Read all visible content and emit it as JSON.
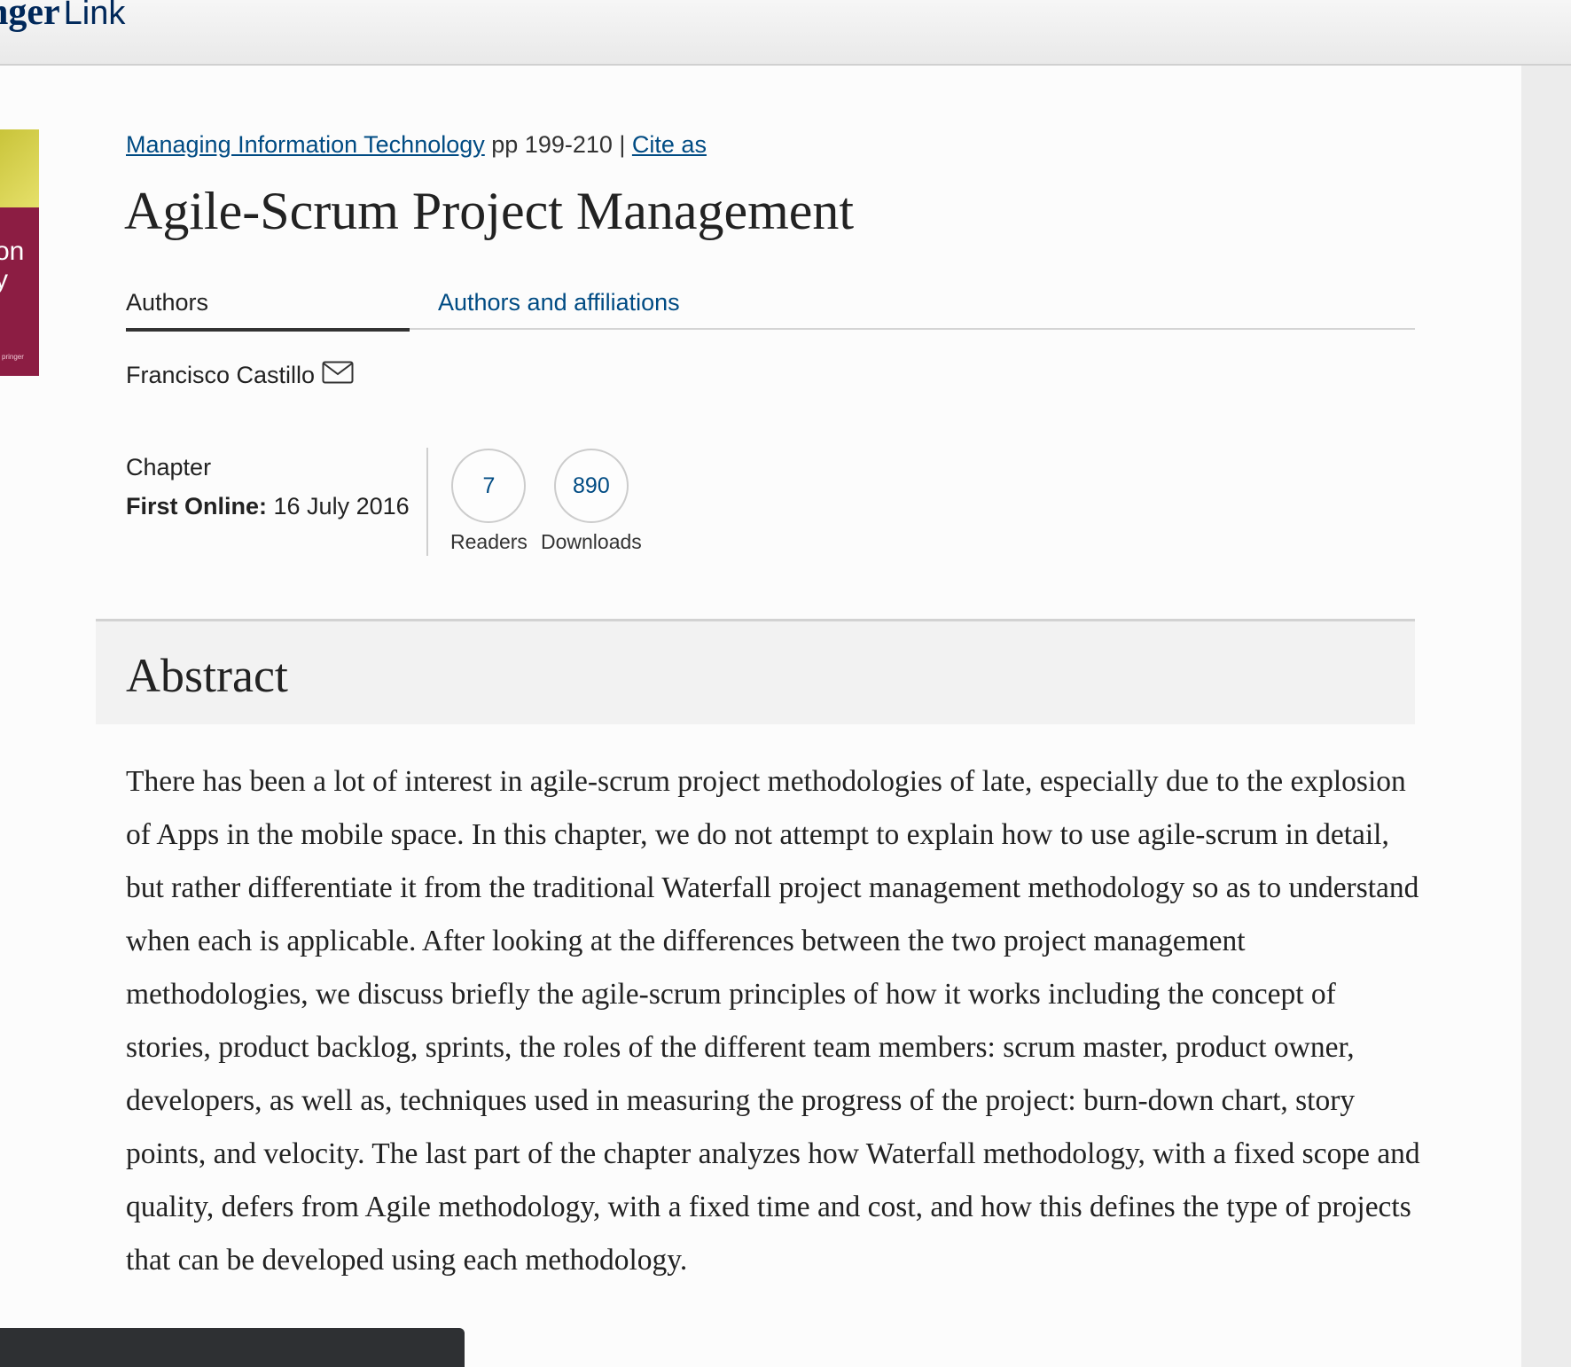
{
  "header": {
    "logo_part1": "nger",
    "logo_part2": "Link"
  },
  "cover": {
    "text": "on\ny",
    "brand": "pringer"
  },
  "breadcrumb": {
    "book_link": "Managing Information Technology",
    "pages": " pp 199-210 | ",
    "cite_link": "Cite as"
  },
  "title": "Agile-Scrum Project Management",
  "tabs": [
    {
      "label": "Authors",
      "active": true
    },
    {
      "label": "Authors and affiliations",
      "active": false
    }
  ],
  "author": {
    "name": "Francisco Castillo",
    "icon": "envelope-icon"
  },
  "meta": {
    "type": "Chapter",
    "first_online_label": "First Online:",
    "first_online_date": " 16 July 2016"
  },
  "metrics": [
    {
      "value": "7",
      "label": "Readers"
    },
    {
      "value": "890",
      "label": "Downloads"
    }
  ],
  "abstract": {
    "heading": "Abstract",
    "text": "There has been a lot of interest in agile-scrum project methodologies of late, especially due to the explosion of Apps in the mobile space. In this chapter, we do not attempt to explain how to use agile-scrum in detail, but rather differentiate it from the traditional Waterfall project management methodology so as to understand when each is applicable. After looking at the differences between the two project management methodologies, we discuss briefly the agile-scrum principles of how it works including the concept of stories, product backlog, sprints, the roles of the different team members: scrum master, product owner, developers, as well as, techniques used in measuring the progress of the project: burn-down chart, story points, and velocity. The last part of the chapter analyzes how Waterfall methodology, with a fixed scope and quality, defers from Agile methodology, with a fixed time and cost, and how this defines the type of projects that can be developed using each methodology."
  },
  "colors": {
    "link": "#004b83",
    "brand": "#00285a",
    "cover_red": "#8c1d43"
  }
}
